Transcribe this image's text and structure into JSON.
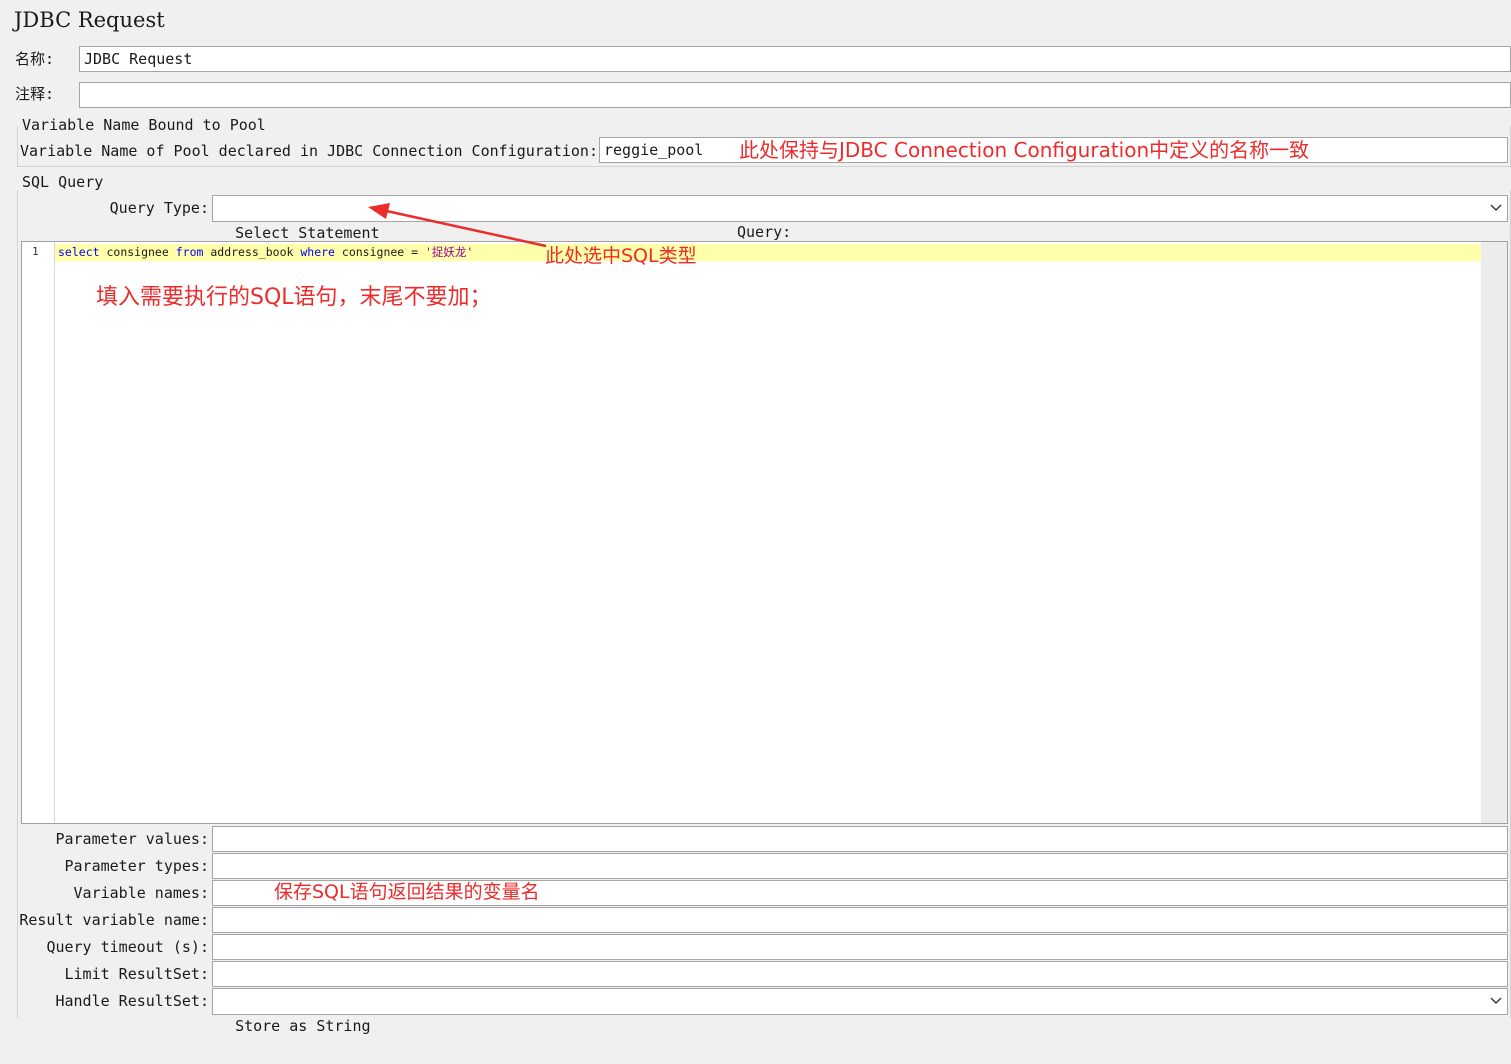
{
  "panel": {
    "title": "JDBC Request"
  },
  "name_field": {
    "label": "名称:",
    "value": "JDBC Request"
  },
  "comment_field": {
    "label": "注释:",
    "value": ""
  },
  "pool_section": {
    "title": "Variable Name Bound to Pool",
    "pool_label": "Variable Name of Pool declared in JDBC Connection Configuration:",
    "pool_value": "reggie_pool"
  },
  "sql_section": {
    "title": "SQL Query",
    "query_type_label": "Query Type:",
    "query_type_value": "Select Statement",
    "query_label": "Query:",
    "line_number": "1",
    "code": {
      "kw_select": "select",
      "t1": " consignee ",
      "kw_from": "from",
      "t2": " address_book ",
      "kw_where": "where",
      "t3": " consignee = ",
      "str": "'捉妖龙'"
    }
  },
  "params": {
    "parameter_values": {
      "label": "Parameter values:",
      "value": ""
    },
    "parameter_types": {
      "label": "Parameter types:",
      "value": ""
    },
    "variable_names": {
      "label": "Variable names:",
      "value": ""
    },
    "result_variable_name": {
      "label": "Result variable name:",
      "value": ""
    },
    "query_timeout": {
      "label": "Query timeout (s):",
      "value": ""
    },
    "limit_resultset": {
      "label": "Limit ResultSet:",
      "value": ""
    },
    "handle_resultset": {
      "label": "Handle ResultSet:",
      "value": "Store as String"
    }
  },
  "annotations": {
    "pool_note": "此处保持与JDBC Connection Configuration中定义的名称一致",
    "query_type_note": "此处选中SQL类型",
    "query_note": "填入需要执行的SQL语句，末尾不要加；",
    "variable_names_note": "保存SQL语句返回结果的变量名"
  },
  "colors": {
    "annotation": "#ee2b2b",
    "keyword": "#0000ff",
    "string": "#990099",
    "current_line": "#ffffaa"
  }
}
